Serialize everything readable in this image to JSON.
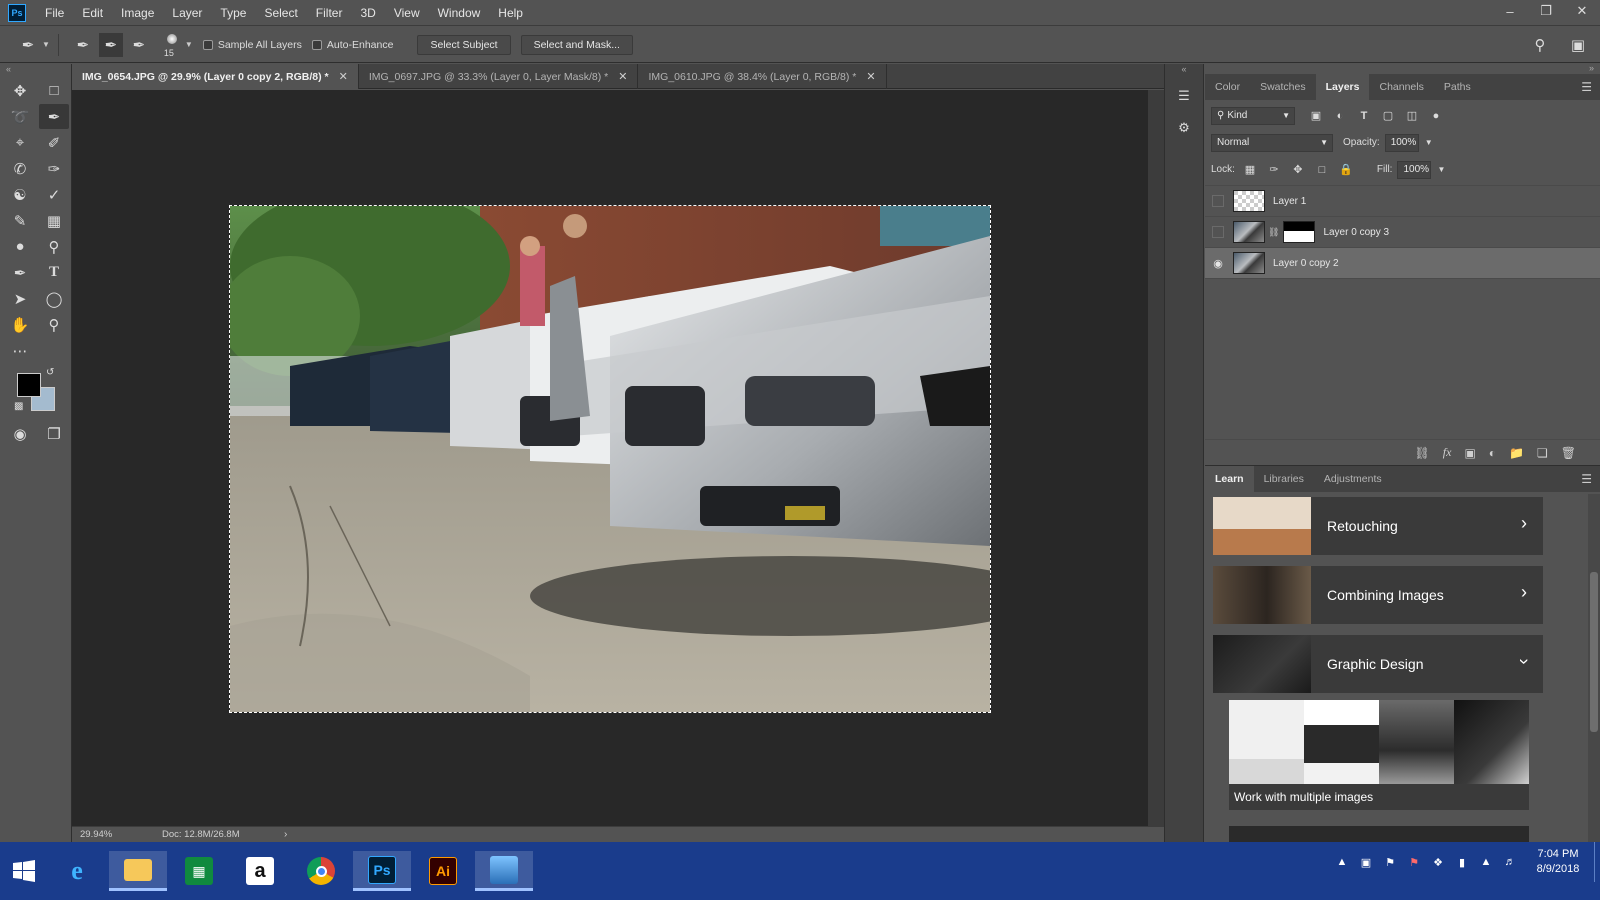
{
  "app": {
    "logo": "Ps"
  },
  "menu": [
    "File",
    "Edit",
    "Image",
    "Layer",
    "Type",
    "Select",
    "Filter",
    "3D",
    "View",
    "Window",
    "Help"
  ],
  "window_controls": [
    "minimize-icon",
    "restore-icon",
    "close-icon"
  ],
  "options": {
    "brush_size": "15",
    "sample_all_layers": "Sample All Layers",
    "auto_enhance": "Auto-Enhance",
    "select_subject": "Select Subject",
    "select_and_mask": "Select and Mask..."
  },
  "tabs": [
    {
      "label": "IMG_0654.JPG @ 29.9% (Layer 0 copy 2, RGB/8) *",
      "active": true
    },
    {
      "label": "IMG_0697.JPG @ 33.3% (Layer 0, Layer Mask/8) *",
      "active": false
    },
    {
      "label": "IMG_0610.JPG @ 38.4% (Layer 0, RGB/8) *",
      "active": false
    }
  ],
  "status": {
    "zoom": "29.94%",
    "doc": "Doc: 12.8M/26.8M"
  },
  "colors": {
    "foreground": "#000000",
    "background": "#a4bbcf",
    "accent": "#31a8ff"
  },
  "panels": {
    "top_tabs": [
      "Color",
      "Swatches",
      "Layers",
      "Channels",
      "Paths"
    ],
    "active_top": "Layers",
    "layers": {
      "filter_kind": "Kind",
      "blend_mode": "Normal",
      "opacity_label": "Opacity:",
      "opacity": "100%",
      "lock_label": "Lock:",
      "fill_label": "Fill:",
      "fill": "100%",
      "items": [
        {
          "name": "Layer 1",
          "visible": false,
          "selected": false
        },
        {
          "name": "Layer 0 copy 3",
          "visible": false,
          "selected": false,
          "mask": true
        },
        {
          "name": "Layer 0 copy 2",
          "visible": true,
          "selected": true
        }
      ]
    },
    "bottom_tabs": [
      "Learn",
      "Libraries",
      "Adjustments"
    ],
    "active_bottom": "Learn",
    "learn": {
      "topics": [
        "Retouching",
        "Combining Images",
        "Graphic Design"
      ],
      "tutorial": "Work with multiple images"
    }
  },
  "taskbar": {
    "apps": [
      "Internet Explorer",
      "File Explorer",
      "Store",
      "Amazon",
      "Chrome",
      "Photoshop",
      "Illustrator",
      "Photos"
    ],
    "app_glyphs": {
      "photoshop": "Ps",
      "illustrator": "Ai",
      "amazon": "a"
    },
    "time": "7:04 PM",
    "date": "8/9/2018"
  }
}
